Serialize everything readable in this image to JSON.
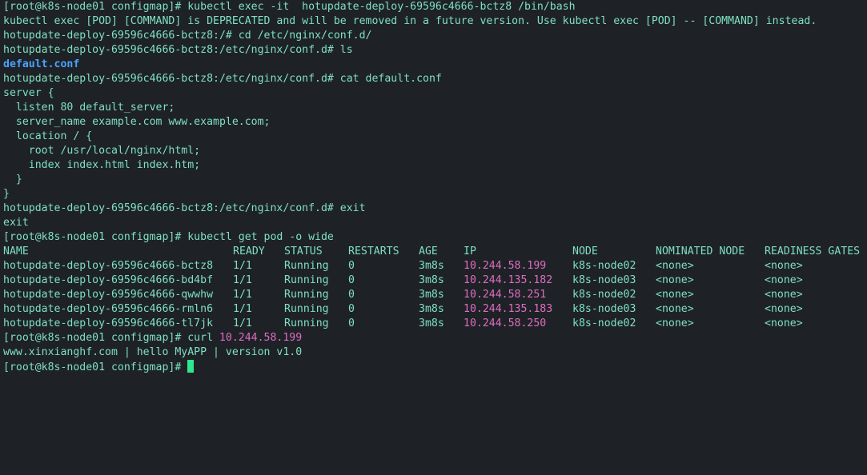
{
  "terminal": {
    "lines": [
      "[root@k8s-node01 configmap]# kubectl exec -it  hotupdate-deploy-69596c4666-bctz8 /bin/bash",
      "kubectl exec [POD] [COMMAND] is DEPRECATED and will be removed in a future version. Use kubectl exec [POD] -- [COMMAND] instead.",
      "hotupdate-deploy-69596c4666-bctz8:/# cd /etc/nginx/conf.d/",
      "hotupdate-deploy-69596c4666-bctz8:/etc/nginx/conf.d# ls",
      "default.conf",
      "hotupdate-deploy-69596c4666-bctz8:/etc/nginx/conf.d# cat default.conf",
      "server {",
      "  listen 80 default_server;",
      "  server_name example.com www.example.com;",
      "  location / {",
      "    root /usr/local/nginx/html;",
      "    index index.html index.htm;",
      "  }",
      "}",
      "hotupdate-deploy-69596c4666-bctz8:/etc/nginx/conf.d# exit",
      "exit",
      "[root@k8s-node01 configmap]# kubectl get pod -o wide"
    ],
    "pod_table": {
      "headers": [
        "NAME",
        "READY",
        "STATUS",
        "RESTARTS",
        "AGE",
        "IP",
        "NODE",
        "NOMINATED NODE",
        "READINESS GATES"
      ],
      "rows": [
        [
          "hotupdate-deploy-69596c4666-bctz8",
          "1/1",
          "Running",
          "0",
          "3m8s",
          "10.244.58.199",
          "k8s-node02",
          "<none>",
          "<none>"
        ],
        [
          "hotupdate-deploy-69596c4666-bd4bf",
          "1/1",
          "Running",
          "0",
          "3m8s",
          "10.244.135.182",
          "k8s-node03",
          "<none>",
          "<none>"
        ],
        [
          "hotupdate-deploy-69596c4666-qwwhw",
          "1/1",
          "Running",
          "0",
          "3m8s",
          "10.244.58.251",
          "k8s-node02",
          "<none>",
          "<none>"
        ],
        [
          "hotupdate-deploy-69596c4666-rmln6",
          "1/1",
          "Running",
          "0",
          "3m8s",
          "10.244.135.183",
          "k8s-node03",
          "<none>",
          "<none>"
        ],
        [
          "hotupdate-deploy-69596c4666-tl7jk",
          "1/1",
          "Running",
          "0",
          "3m8s",
          "10.244.58.250",
          "k8s-node02",
          "<none>",
          "<none>"
        ]
      ]
    },
    "curl_prompt": "[root@k8s-node01 configmap]# curl ",
    "curl_ip": "10.244.58.199",
    "curl_output": "www.xinxianghf.com | hello MyAPP | version v1.0",
    "final_prompt": "[root@k8s-node01 configmap]# "
  },
  "colors": {
    "background": "#1e2227",
    "text": "#7fe0c0",
    "directory": "#4aa3ff",
    "ip_highlight": "#e06cc0",
    "cursor": "#2ee88e"
  }
}
